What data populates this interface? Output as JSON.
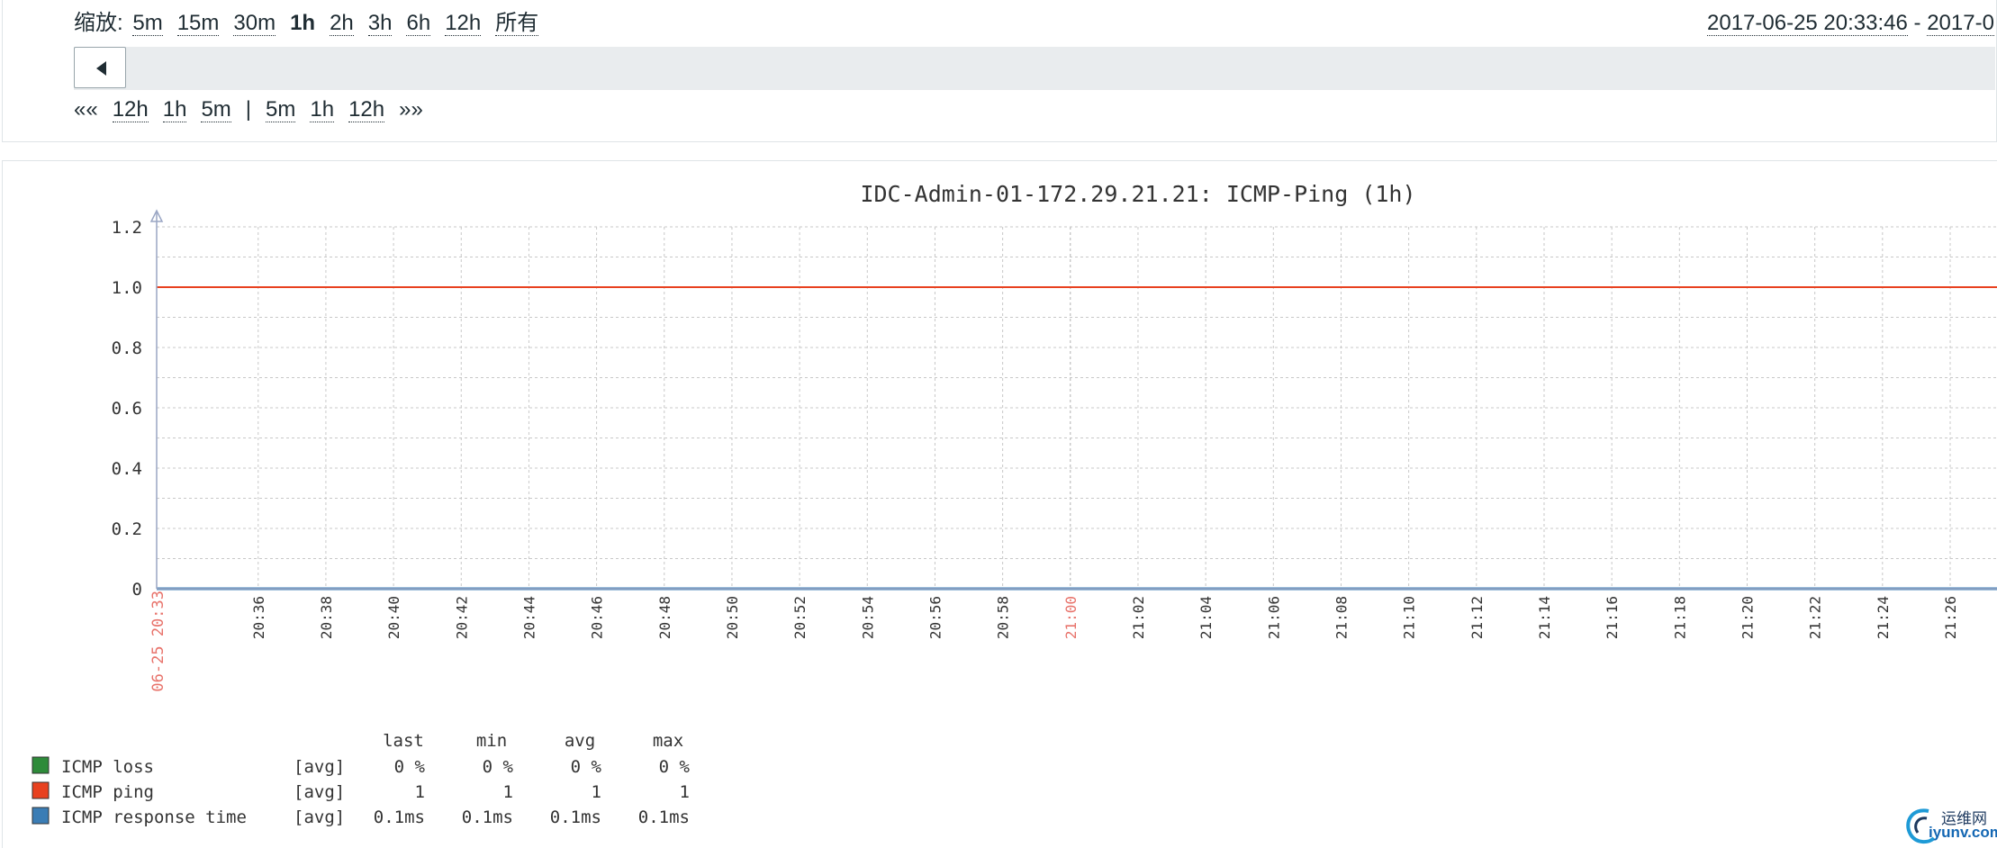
{
  "toolbar": {
    "zoom_label": "缩放:",
    "zoom_options": [
      "5m",
      "15m",
      "30m",
      "1h",
      "2h",
      "3h",
      "6h",
      "12h",
      "所有"
    ],
    "active_zoom": "1h",
    "period_from": "2017-06-25 20:33:46",
    "period_separator": " - ",
    "period_to_partial": "2017-0",
    "nav_back_fast": "««",
    "nav_back": [
      "12h",
      "1h",
      "5m"
    ],
    "nav_separator": "|",
    "nav_forward": [
      "5m",
      "1h",
      "12h"
    ],
    "nav_forward_fast": "»»",
    "scroll_left_icon": "triangle-left-icon"
  },
  "chart_data": {
    "type": "line",
    "title": "IDC-Admin-01-172.29.21.21: ICMP-Ping (1h)",
    "ylim": [
      0,
      1.2
    ],
    "y_ticks": [
      "0",
      "0.2",
      "0.4",
      "0.6",
      "0.8",
      "1.0",
      "1.2"
    ],
    "x_start_label": "06-25 20:33",
    "x_ticks": [
      "20:36",
      "20:38",
      "20:40",
      "20:42",
      "20:44",
      "20:46",
      "20:48",
      "20:50",
      "20:52",
      "20:54",
      "20:56",
      "20:58",
      "21:00",
      "21:02",
      "21:04",
      "21:06",
      "21:08",
      "21:10",
      "21:12",
      "21:14",
      "21:16",
      "21:18",
      "21:20",
      "21:22",
      "21:24",
      "21:26"
    ],
    "highlight_ticks": [
      "06-25 20:33",
      "21:00"
    ],
    "grid": true,
    "series": [
      {
        "name": "ICMP loss",
        "color": "#2e8b3a",
        "x": [
          "20:33",
          "21:26"
        ],
        "y": [
          0,
          0
        ]
      },
      {
        "name": "ICMP ping",
        "color": "#e8411f",
        "x": [
          "20:33",
          "21:26"
        ],
        "y": [
          1,
          1
        ]
      },
      {
        "name": "ICMP response time",
        "color": "#3b7db5",
        "x": [
          "20:33",
          "21:26"
        ],
        "y": [
          0.0001,
          0.0001
        ]
      }
    ],
    "legend": {
      "headers": [
        "last",
        "min",
        "avg",
        "max"
      ],
      "rows": [
        {
          "name": "ICMP loss",
          "func": "[avg]",
          "color": "#2e8b3a",
          "values": [
            "0 %",
            "0 %",
            "0 %",
            "0 %"
          ]
        },
        {
          "name": "ICMP ping",
          "func": "[avg]",
          "color": "#e8411f",
          "values": [
            "1",
            "1",
            "1",
            "1"
          ]
        },
        {
          "name": "ICMP response time",
          "func": "[avg]",
          "color": "#3b7db5",
          "values": [
            "0.1ms",
            "0.1ms",
            "0.1ms",
            "0.1ms"
          ]
        }
      ]
    }
  },
  "watermark": {
    "line1": "运维网",
    "line2": "iyunv.com"
  }
}
